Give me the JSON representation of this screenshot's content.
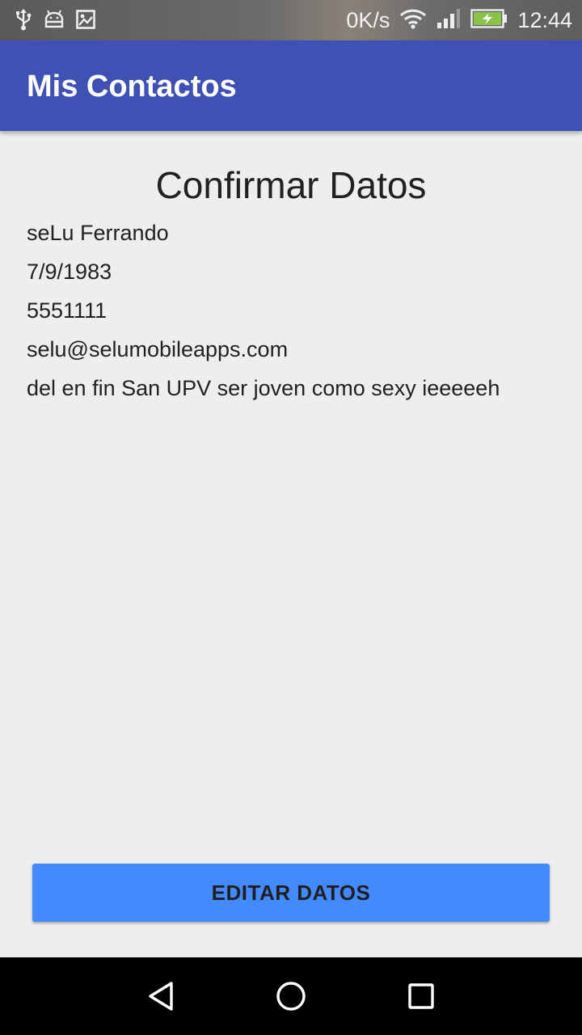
{
  "status_bar": {
    "speed": "0K/s",
    "time": "12:44",
    "icons": [
      "usb-icon",
      "android-debug-icon",
      "image-icon",
      "wifi-icon",
      "cell-signal-icon",
      "battery-charging-icon"
    ]
  },
  "app_bar": {
    "title": "Mis Contactos",
    "color": "#3f51b5"
  },
  "confirm": {
    "heading": "Confirmar Datos",
    "name": "seLu Ferrando",
    "date": "7/9/1983",
    "phone": "5551111",
    "email": "selu@selumobileapps.com",
    "description": "del en fin San UPV ser joven como sexy ieeeeeh"
  },
  "actions": {
    "edit_label": "EDITAR DATOS",
    "button_color": "#448aff"
  },
  "nav_bar": {
    "icons": [
      "back-icon",
      "home-icon",
      "recents-icon"
    ]
  }
}
